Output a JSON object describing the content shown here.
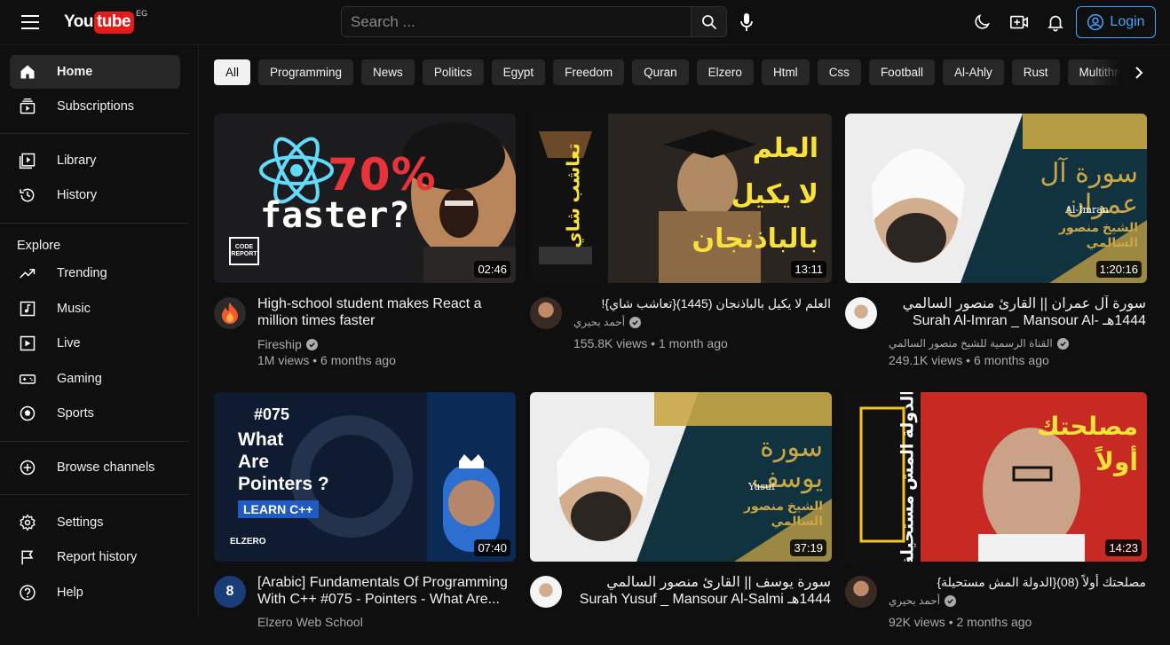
{
  "header": {
    "logo_you": "You",
    "logo_tube": "tube",
    "country_code": "EG",
    "search_placeholder": "Search ...",
    "login_label": "Login"
  },
  "sidebar": {
    "items": [
      {
        "label": "Home",
        "icon": "home-icon",
        "active": true
      },
      {
        "label": "Subscriptions",
        "icon": "subscriptions-icon"
      },
      {
        "label": "Library",
        "icon": "library-icon"
      },
      {
        "label": "History",
        "icon": "history-icon"
      },
      {
        "label": "Trending",
        "icon": "trending-icon"
      },
      {
        "label": "Music",
        "icon": "music-icon"
      },
      {
        "label": "Live",
        "icon": "live-icon"
      },
      {
        "label": "Gaming",
        "icon": "gaming-icon"
      },
      {
        "label": "Sports",
        "icon": "sports-icon"
      },
      {
        "label": "Browse channels",
        "icon": "plus-circle-icon"
      },
      {
        "label": "Settings",
        "icon": "settings-icon"
      },
      {
        "label": "Report history",
        "icon": "flag-icon"
      },
      {
        "label": "Help",
        "icon": "help-icon"
      }
    ],
    "explore_label": "Explore"
  },
  "chips": [
    "All",
    "Programming",
    "News",
    "Politics",
    "Egypt",
    "Freedom",
    "Quran",
    "Elzero",
    "Html",
    "Css",
    "Football",
    "Al-Ahly",
    "Rust",
    "Multithreading"
  ],
  "videos": [
    {
      "title": "High-school student makes React a million times faster",
      "channel": "Fireship",
      "verified": true,
      "stats": "1M views • 6 months ago",
      "duration": "02:46",
      "thumb_text": {
        "percent": "70%",
        "faster": "faster?",
        "badge": "CODE REPORT"
      }
    },
    {
      "title": "العلم لا يكيل بالباذنجان (1445){تعاشب شاي}!",
      "channel": "أحمد بحيري",
      "verified": true,
      "stats": "155.8K views • 1 month ago",
      "duration": "13:11",
      "thumb_text": {
        "line1": "العلم",
        "line2": "لا يكيل",
        "line3": "بالباذنجان",
        "side": "تعاشب شاي"
      }
    },
    {
      "title": "سورة آل عمران || القارئ منصور السالمي 1444هـ Surah Al-Imran _ Mansour Al-Salmi",
      "channel": "القناة الرسمية للشيخ منصور السالمي",
      "verified": true,
      "stats": "249.1K views • 6 months ago",
      "duration": "1:20:16",
      "thumb_text": {
        "surah": "سورة آل عمران",
        "latin": "Al-Imran",
        "sheikh": "الشيخ منصور السالمي"
      }
    },
    {
      "title": "[Arabic] Fundamentals Of Programming With C++ #075 - Pointers - What Are...",
      "channel": "Elzero Web School",
      "verified": false,
      "stats": "",
      "duration": "07:40",
      "thumb_text": {
        "num": "#075",
        "l1": "What",
        "l2": "Are",
        "l3": "Pointers ?",
        "learn": "LEARN C++",
        "brand": "ELZERO"
      }
    },
    {
      "title": "سورة يوسف || القارئ منصور السالمي 1444هـ Surah Yusuf _ Mansour Al-Salmi",
      "channel": "",
      "verified": false,
      "stats": "",
      "duration": "37:19",
      "thumb_text": {
        "surah": "سورة يوسف",
        "latin": "Yusuf",
        "sheikh": "الشيخ منصور السالمي"
      }
    },
    {
      "title": "مصلحتك أولاً (08){الدولة المش مستحيلة}",
      "channel": "أحمد بحيري",
      "verified": true,
      "stats": "92K views • 2 months ago",
      "duration": "14:23",
      "thumb_text": {
        "r1": "مصلحتك",
        "r2": "أولاً",
        "side": "الدولة المش مستحيلة"
      }
    }
  ],
  "colors": {
    "background": "#0f0f0f",
    "accent_login": "#3ea6ff",
    "logo_red": "#e21b1b",
    "chip_bg": "#272727",
    "react_blue": "#61dafb",
    "react_red": "#e8333a"
  }
}
